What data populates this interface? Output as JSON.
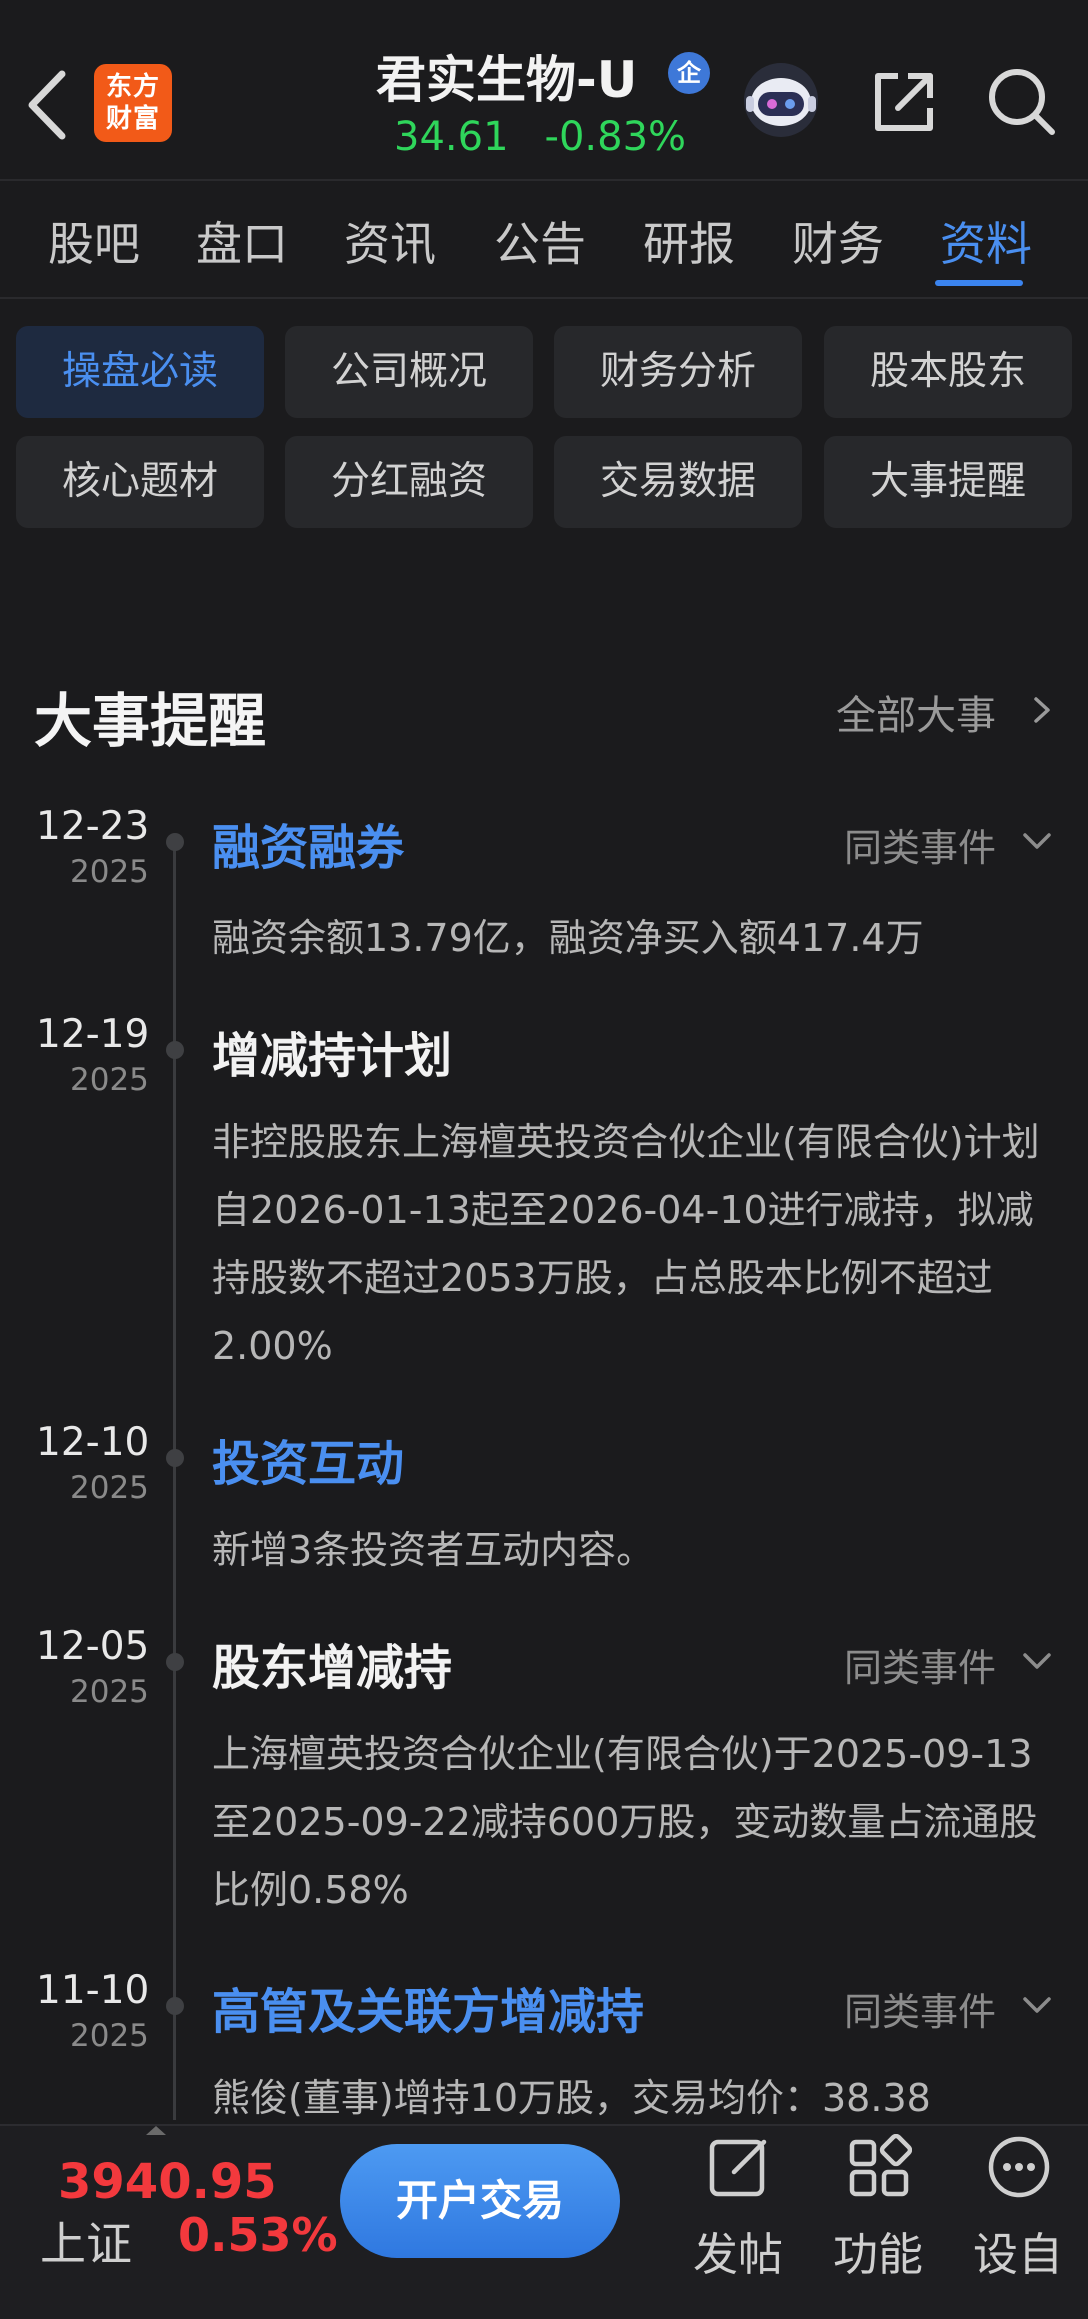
{
  "header": {
    "logo_text_line1": "东方",
    "logo_text_line2": "财富",
    "stock_name": "君实生物-U",
    "badge": "企",
    "price": "34.61",
    "change_pct": "-0.83%",
    "price_color": "#2fd65b",
    "icons": [
      "back-icon",
      "robot-assistant-icon",
      "share-icon",
      "search-icon"
    ]
  },
  "tabs": [
    "股吧",
    "盘口",
    "资讯",
    "公告",
    "研报",
    "财务",
    "资料"
  ],
  "active_tab": "资料",
  "chips": {
    "row1": [
      "操盘必读",
      "公司概况",
      "财务分析",
      "股本股东"
    ],
    "row2": [
      "核心题材",
      "分红融资",
      "交易数据",
      "大事提醒"
    ],
    "active": "操盘必读"
  },
  "section": {
    "title": "大事提醒",
    "all_link": "全部大事"
  },
  "events": [
    {
      "date": "12-23",
      "year": "2025",
      "title": "融资融券",
      "similar": "同类事件",
      "desc": "融资余额13.79亿，融资净买入额417.4万"
    },
    {
      "date": "12-19",
      "year": "2025",
      "title": "增减持计划",
      "similar": "",
      "desc": "非控股股东上海檀英投资合伙企业(有限合伙)计划自2026-01-13起至2026-04-10进行减持，拟减持股数不超过2053万股，占总股本比例不超过2.00%"
    },
    {
      "date": "12-10",
      "year": "2025",
      "title": "投资互动",
      "similar": "",
      "desc": "新增3条投资者互动内容。"
    },
    {
      "date": "12-05",
      "year": "2025",
      "title": "股东增减持",
      "similar": "同类事件",
      "desc": "上海檀英投资合伙企业(有限合伙)于2025-09-13至2025-09-22减持600万股，变动数量占流通股比例0.58%"
    },
    {
      "date": "11-10",
      "year": "2025",
      "title": "高管及关联方增减持",
      "similar": "同类事件",
      "desc": "熊俊(董事)增持10万股，交易均价：38.38"
    }
  ],
  "bottom": {
    "index_value": "3940.95",
    "index_name": "上证",
    "index_pct": "0.53%",
    "open_button": "开户交易",
    "post": "发帖",
    "function": "功能",
    "settings": "设自"
  }
}
